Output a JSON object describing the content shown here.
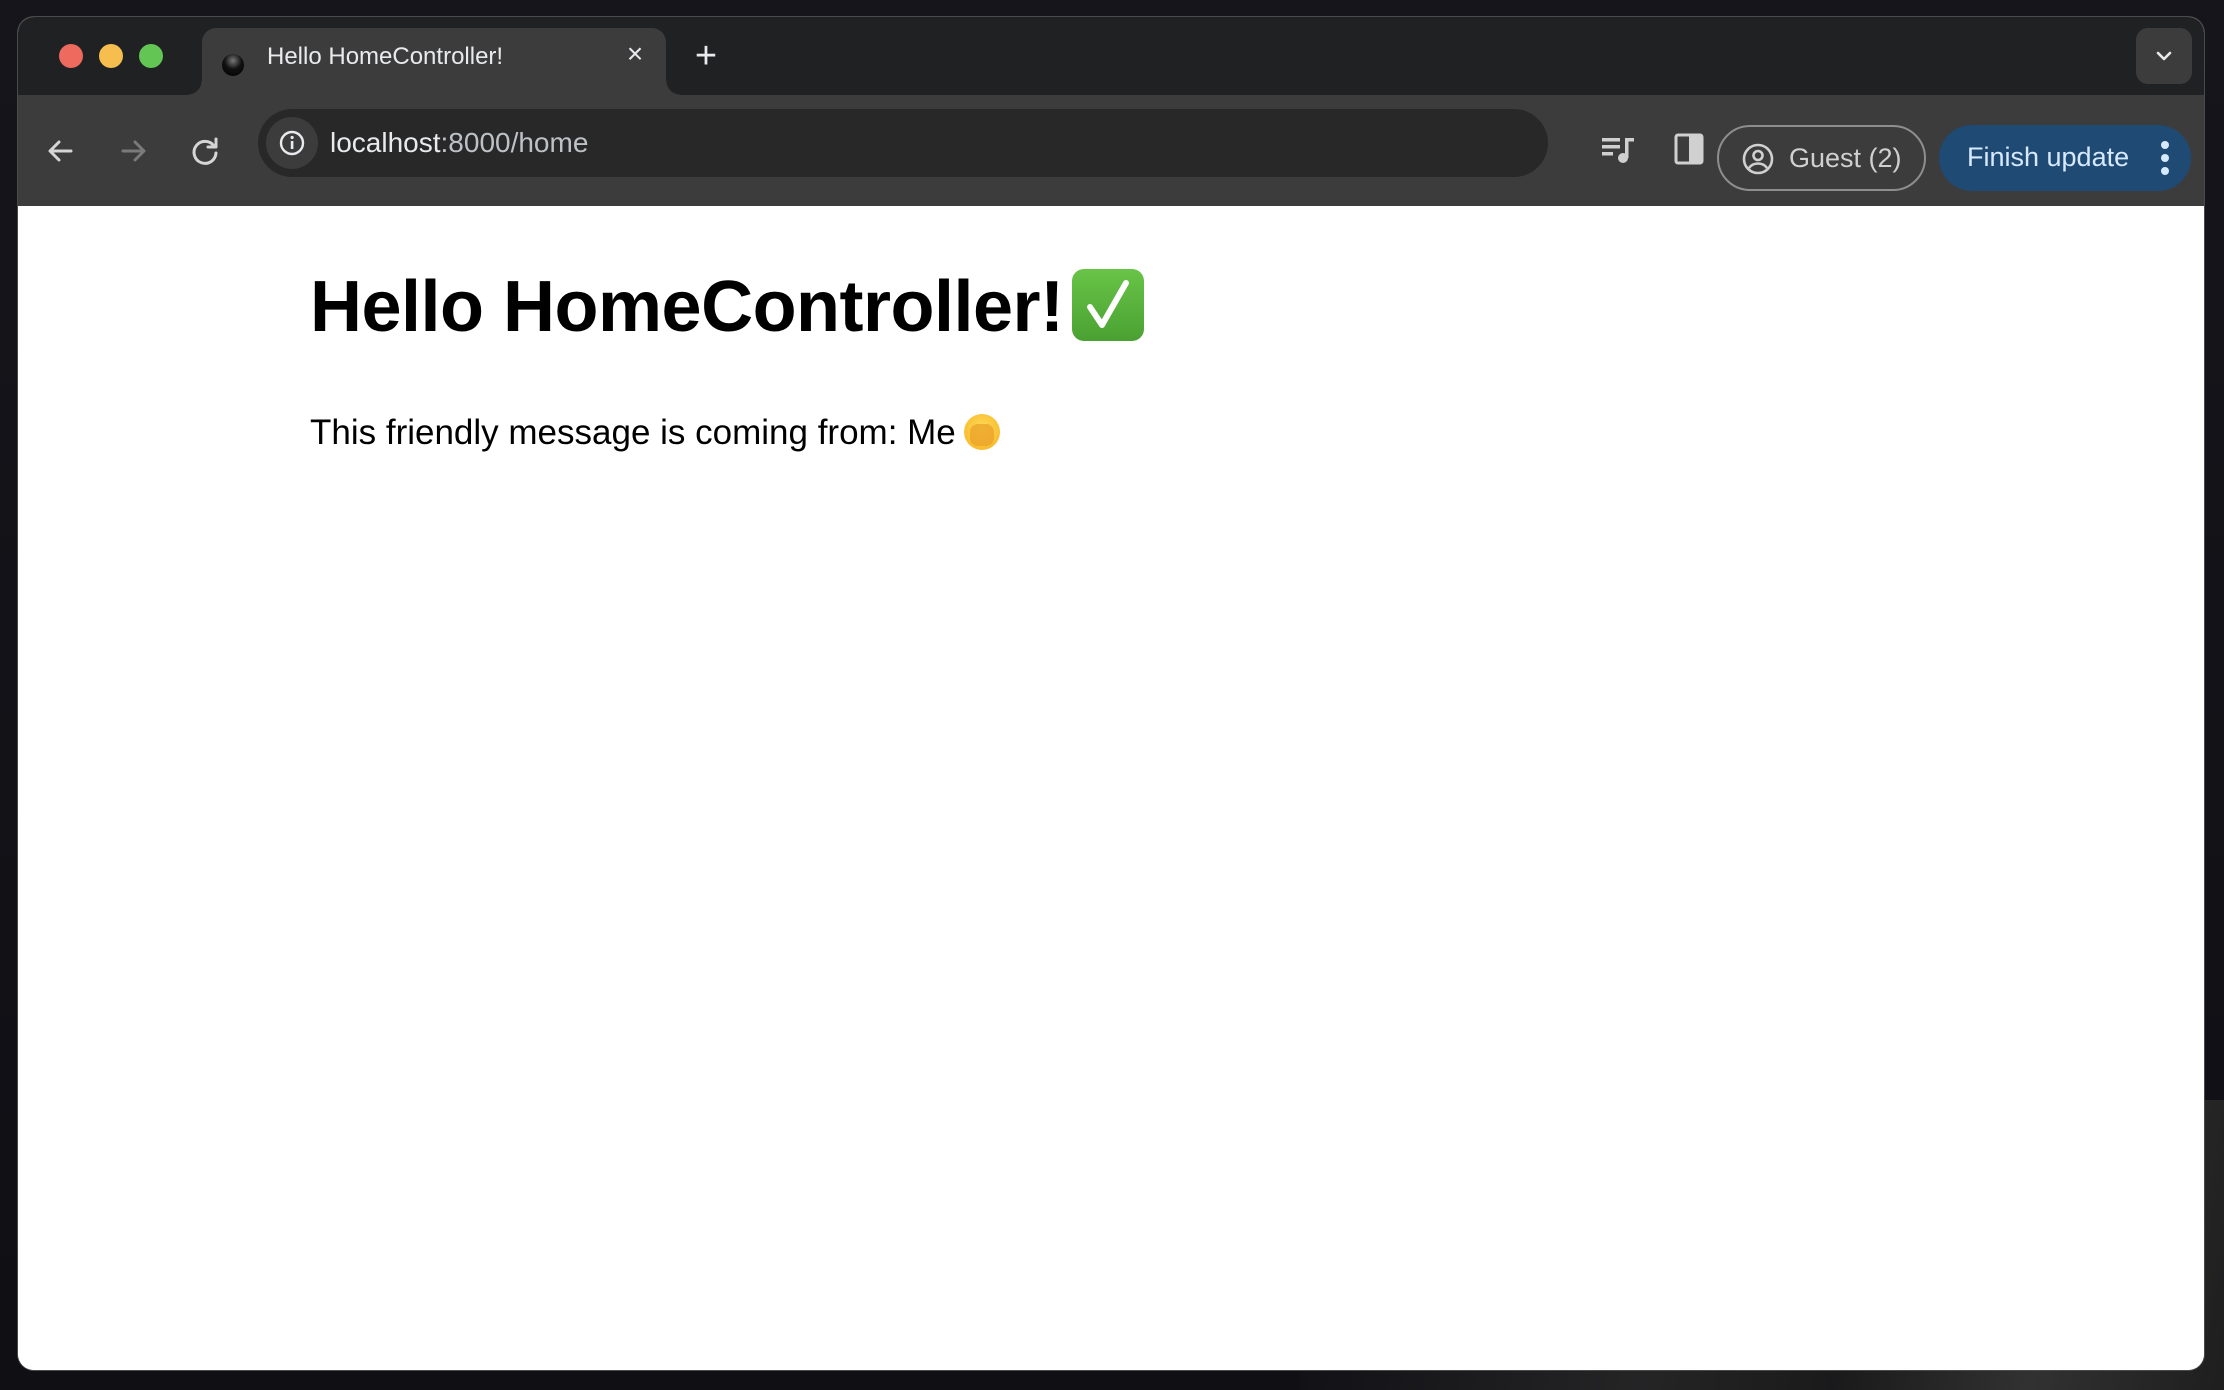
{
  "browser": {
    "tab": {
      "title": "Hello HomeController!",
      "favicon": "dark-globe-favicon",
      "close_icon": "close-icon"
    },
    "new_tab_icon": "plus-icon",
    "tab_search_icon": "chevron-down-icon",
    "toolbar": {
      "back_icon": "arrow-left-icon",
      "forward_icon": "arrow-right-icon",
      "reload_icon": "reload-icon",
      "site_info_icon": "info-icon",
      "url_host": "localhost",
      "url_rest": ":8000/home",
      "media_icon": "media-queue-icon",
      "side_panel_icon": "side-panel-icon",
      "profile": {
        "icon": "account-circle-icon",
        "label": "Guest (2)"
      },
      "update_button": {
        "label": "Finish update",
        "menu_icon": "more-vert-icon"
      }
    },
    "colors": {
      "tab_strip": "#202122",
      "toolbar": "#3c3c3c",
      "omnibox": "#282828",
      "update_button": "#1e4a73",
      "traffic_red": "#ee6a5f",
      "traffic_yellow": "#f5be4f",
      "traffic_green": "#62c554"
    }
  },
  "page": {
    "heading": "Hello HomeController!",
    "heading_emoji": "✅",
    "message": "This friendly message is coming from: Me",
    "message_emoji": "🫣"
  }
}
